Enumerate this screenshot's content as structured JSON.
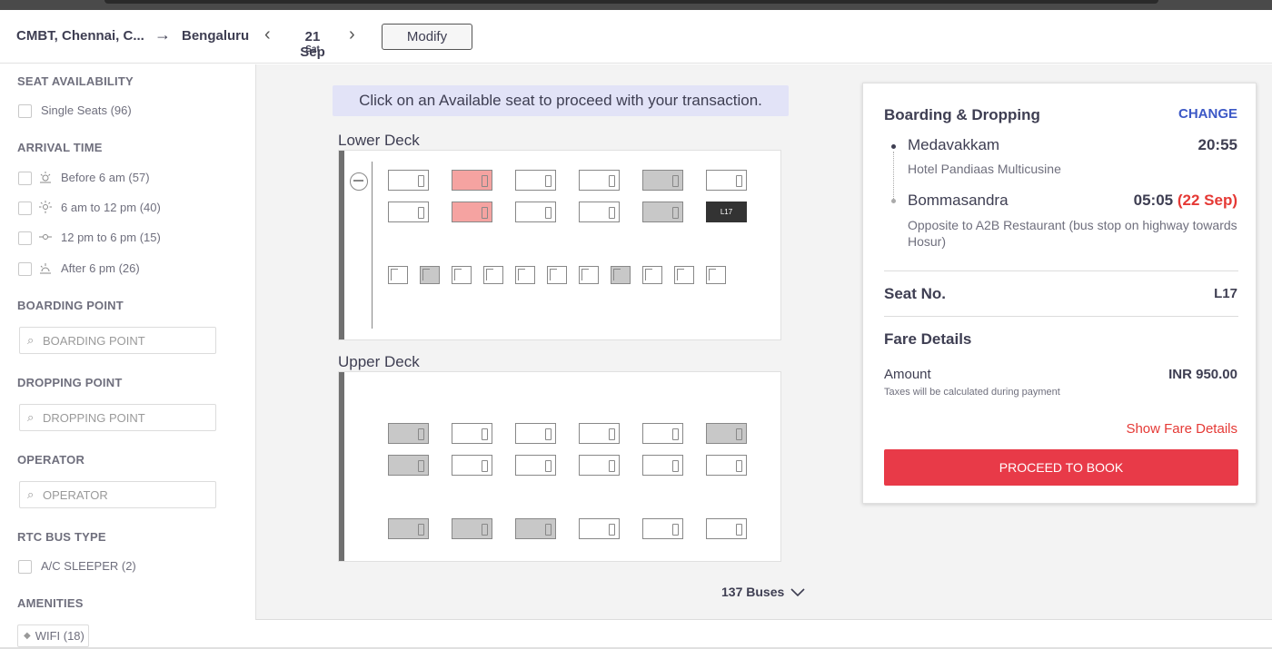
{
  "header": {
    "source": "CMBT, Chennai, C...",
    "arrow": "→",
    "destination": "Bengaluru",
    "prev": "‹",
    "date": "21 Sep",
    "day": "Sat",
    "next": "›",
    "modify_label": "Modify"
  },
  "sidebar": {
    "seat_availability": {
      "heading": "SEAT AVAILABILITY",
      "single_seats": "Single Seats (96)"
    },
    "arrival_time": {
      "heading": "ARRIVAL TIME",
      "options": [
        {
          "label": "Before 6 am (57)",
          "icon": "sunrise-icon"
        },
        {
          "label": "6 am to 12 pm (40)",
          "icon": "sun-icon"
        },
        {
          "label": "12 pm to 6 pm (15)",
          "icon": "afternoon-icon"
        },
        {
          "label": "After 6 pm (26)",
          "icon": "sunset-icon"
        }
      ]
    },
    "boarding_point": {
      "heading": "BOARDING POINT",
      "placeholder": "BOARDING POINT"
    },
    "dropping_point": {
      "heading": "DROPPING POINT",
      "placeholder": "DROPPING POINT"
    },
    "operator": {
      "heading": "OPERATOR",
      "placeholder": "OPERATOR"
    },
    "rtc_bus_type": {
      "heading": "RTC BUS TYPE",
      "option": "A/C SLEEPER (2)"
    },
    "amenities": {
      "heading": "AMENITIES",
      "wifi": "WIFI (18)"
    }
  },
  "main": {
    "notice": "Click on an Available seat to proceed with your transaction.",
    "lower_deck_label": "Lower Deck",
    "upper_deck_label": "Upper Deck",
    "selected_seat_label": "L17",
    "buses_count": "137 Buses",
    "buses_chevron": "⌵"
  },
  "lower_deck": {
    "row1": [
      "available",
      "ladies",
      "available",
      "available",
      "booked",
      "available"
    ],
    "row2": [
      "available",
      "ladies",
      "available",
      "available",
      "booked",
      "selected"
    ],
    "seaters": [
      "available",
      "booked",
      "available",
      "available",
      "available",
      "available",
      "available",
      "booked",
      "available",
      "available",
      "available"
    ]
  },
  "upper_deck": {
    "row1": [
      "booked",
      "available",
      "available",
      "available",
      "available",
      "booked"
    ],
    "row2": [
      "booked",
      "available",
      "available",
      "available",
      "available",
      "available"
    ],
    "row3": [
      "booked",
      "booked",
      "booked",
      "available",
      "available",
      "available"
    ]
  },
  "panel": {
    "title": "Boarding & Dropping",
    "change": "CHANGE",
    "boarding": {
      "name": "Medavakkam",
      "time": "20:55",
      "address": "Hotel Pandiaas Multicusine"
    },
    "dropping": {
      "name": "Bommasandra",
      "time": "05:05",
      "next_day": "(22 Sep)",
      "address": "Opposite to A2B Restaurant (bus stop on highway towards Hosur)"
    },
    "seat_no_label": "Seat No.",
    "seat_no_value": "L17",
    "fare_details_label": "Fare Details",
    "amount_label": "Amount",
    "amount_value": "INR 950.00",
    "tax_note": "Taxes will be calculated during payment",
    "show_fare_details": "Show Fare Details",
    "proceed_label": "PROCEED TO BOOK"
  },
  "colors": {
    "accent_red": "#e83a48",
    "link_blue": "#3c58c6",
    "ladies_seat": "#f5a3a1",
    "booked_seat": "#c8c8c8",
    "notice_bg": "#e2e3f7"
  }
}
